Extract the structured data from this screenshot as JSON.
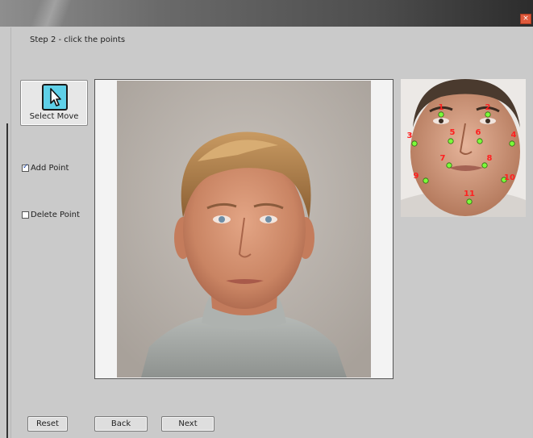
{
  "window": {
    "close_glyph": "×"
  },
  "instruction": "Step 2 - click the points",
  "tools": {
    "select_move": {
      "label": "Select Move",
      "icon": "cursor-arrow-icon"
    },
    "add_point": {
      "label": "Add Point",
      "checked": true
    },
    "delete_point": {
      "label": "Delete Point",
      "checked": false
    }
  },
  "reference": {
    "points": [
      "1",
      "2",
      "3",
      "4",
      "5",
      "6",
      "7",
      "8",
      "9",
      "10",
      "11"
    ],
    "point_color": "#7cfc3a",
    "label_color": "#ff2020"
  },
  "buttons": {
    "reset": "Reset",
    "back": "Back",
    "next": "Next"
  }
}
